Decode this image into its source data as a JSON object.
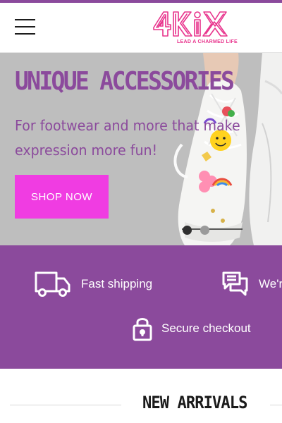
{
  "header": {
    "menu_icon": "hamburger-menu-icon",
    "logo_text": "4KiX",
    "tagline": "LEAD A CHARMED LIFE",
    "colors": {
      "topline": "#8b4a9c",
      "logo": "#e8338c"
    }
  },
  "hero": {
    "title": "UNIQUE ACCESSORIES",
    "subtitle_line1": "For footwear and more that make",
    "subtitle_line2": "expression more fun!",
    "cta_label": "SHOP NOW",
    "slides_count": 2,
    "active_slide": 1,
    "colors": {
      "text": "#8b4a9c",
      "cta": "#f03ce2",
      "background": "#bcbcbc"
    }
  },
  "features": {
    "items": [
      {
        "icon": "truck-icon",
        "label": "Fast shipping"
      },
      {
        "icon": "chat-icon",
        "label": "We'r"
      },
      {
        "icon": "lock-icon",
        "label": "Secure checkout"
      }
    ],
    "colors": {
      "background": "#8b4a9c",
      "text": "#ffffff"
    }
  },
  "arrivals": {
    "title": "NEW ARRIVALS"
  }
}
